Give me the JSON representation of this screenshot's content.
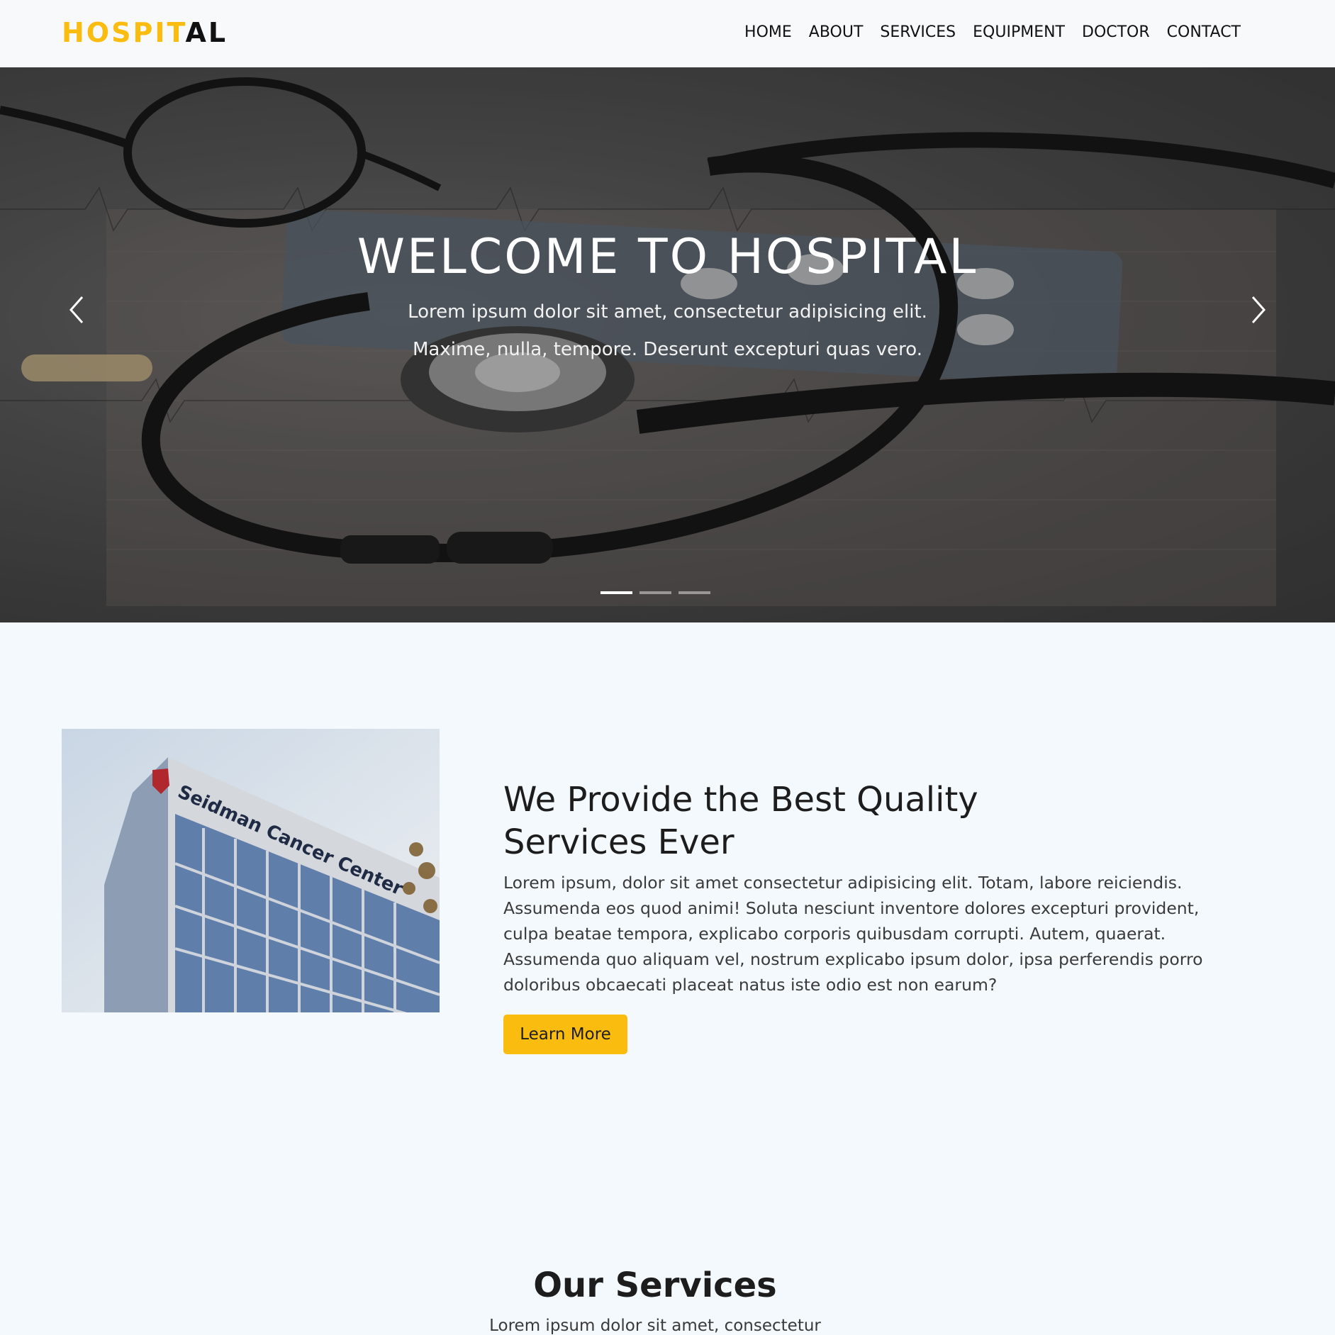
{
  "brand": {
    "part1": "HOSPIT",
    "part2": "AL",
    "accent_color": "#fbbc10"
  },
  "nav": {
    "items": [
      {
        "label": "HOME"
      },
      {
        "label": "ABOUT"
      },
      {
        "label": "SERVICES"
      },
      {
        "label": "EQUIPMENT"
      },
      {
        "label": "DOCTOR"
      },
      {
        "label": "CONTACT"
      }
    ]
  },
  "hero": {
    "title": "WELCOME TO HOSPITAL",
    "subtitle_line1": "Lorem ipsum dolor sit amet, consectetur adipisicing elit.",
    "subtitle_line2": "Maxime, nulla, tempore. Deserunt excepturi quas vero.",
    "prev_icon": "chevron-left-icon",
    "next_icon": "chevron-right-icon",
    "slides": 3,
    "active_slide": 1
  },
  "about": {
    "image_sign": "Seidman Cancer Center",
    "title_line1": "We Provide the Best Quality",
    "title_line2": "Services Ever",
    "text": "Lorem ipsum, dolor sit amet consectetur adipisicing elit. Totam, labore reiciendis. Assumenda eos quod animi! Soluta nesciunt inventore dolores excepturi provident, culpa beatae tempora, explicabo corporis quibusdam corrupti. Autem, quaerat. Assumenda quo aliquam vel, nostrum explicabo ipsum dolor, ipsa perferendis porro doloribus obcaecati placeat natus iste odio est non earum?",
    "button_label": "Learn More"
  },
  "services": {
    "title": "Our Services",
    "subtitle": "Lorem ipsum dolor sit amet, consectetur"
  }
}
